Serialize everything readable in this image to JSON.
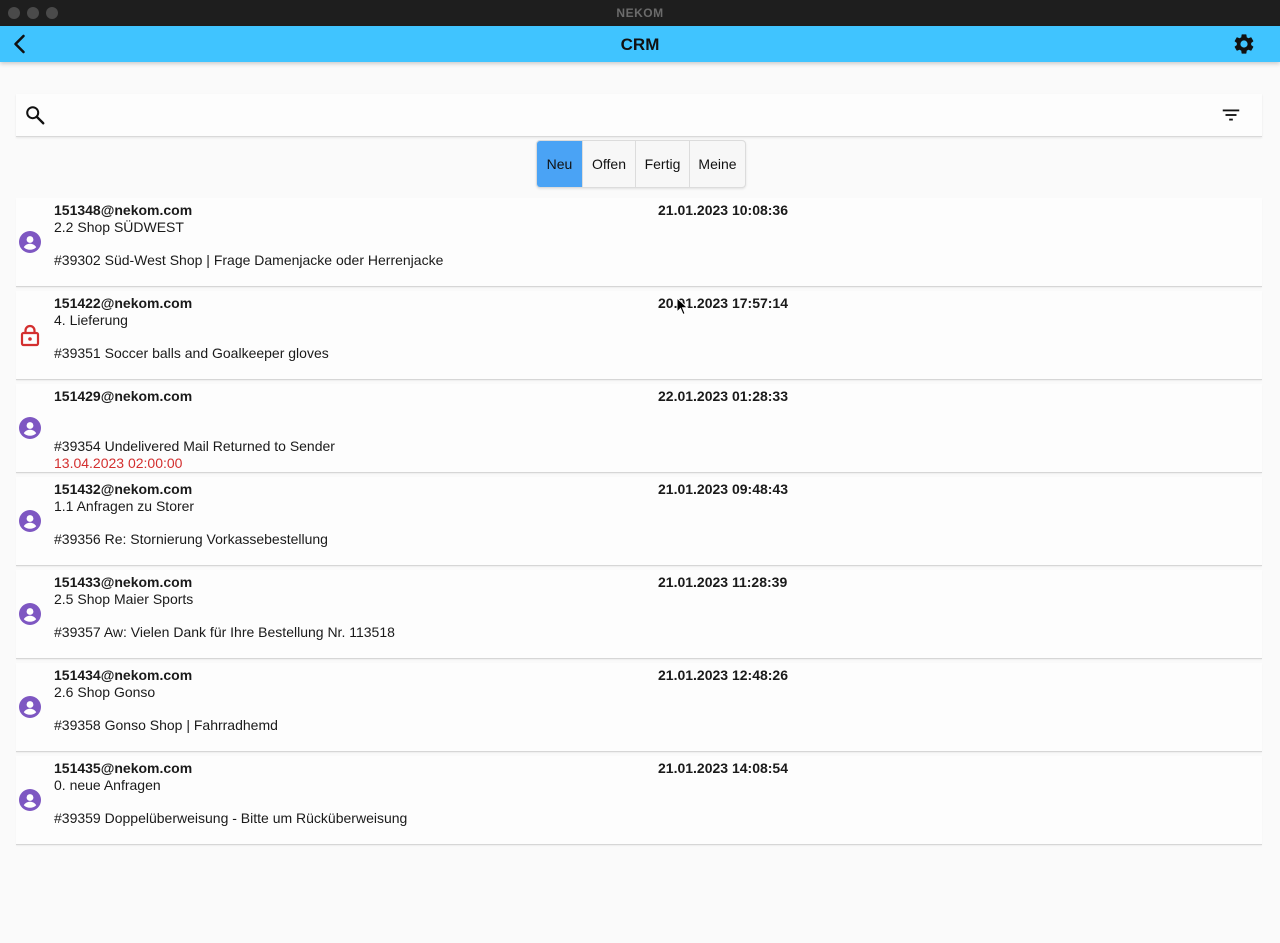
{
  "window": {
    "title": "NEKOM"
  },
  "appbar": {
    "title": "CRM",
    "back_icon": "arrow-back-icon",
    "settings_icon": "gear-icon"
  },
  "search": {
    "value": "",
    "placeholder": "",
    "filter_icon": "filter-list-icon"
  },
  "tabs": [
    {
      "label": "Neu",
      "active": true
    },
    {
      "label": "Offen",
      "active": false
    },
    {
      "label": "Fertig",
      "active": false
    },
    {
      "label": "Meine",
      "active": false
    }
  ],
  "colors": {
    "appbar": "#40c4ff",
    "active_tab": "#4aa3f5",
    "person_icon": "#7e57c2",
    "lock_icon": "#d32f2f",
    "due_date": "#d32f2f"
  },
  "tickets": [
    {
      "icon": "person-icon",
      "email": "151348@nekom.com",
      "date": "21.01.2023 10:08:36",
      "category": "2.2 Shop SÜDWEST",
      "subject": "#39302 Süd-West Shop | Frage Damenjacke oder Herrenjacke",
      "due": ""
    },
    {
      "icon": "lock-icon",
      "email": "151422@nekom.com",
      "date": "20.01.2023 17:57:14",
      "category": "4. Lieferung",
      "subject": "#39351 Soccer balls and Goalkeeper gloves",
      "due": ""
    },
    {
      "icon": "person-icon",
      "email": "151429@nekom.com",
      "date": "22.01.2023 01:28:33",
      "category": "",
      "subject": "#39354 Undelivered Mail Returned to Sender",
      "due": "13.04.2023 02:00:00"
    },
    {
      "icon": "person-icon",
      "email": "151432@nekom.com",
      "date": "21.01.2023 09:48:43",
      "category": "1.1 Anfragen zu Storer",
      "subject": "#39356 Re: Stornierung Vorkassebestellung",
      "due": ""
    },
    {
      "icon": "person-icon",
      "email": "151433@nekom.com",
      "date": "21.01.2023 11:28:39",
      "category": "2.5 Shop Maier Sports",
      "subject": "#39357 Aw: Vielen Dank für Ihre Bestellung Nr. 113518",
      "due": ""
    },
    {
      "icon": "person-icon",
      "email": "151434@nekom.com",
      "date": "21.01.2023 12:48:26",
      "category": "2.6 Shop Gonso",
      "subject": "#39358 Gonso Shop | Fahrradhemd",
      "due": ""
    },
    {
      "icon": "person-icon",
      "email": "151435@nekom.com",
      "date": "21.01.2023 14:08:54",
      "category": "0. neue Anfragen",
      "subject": "#39359 Doppelüberweisung - Bitte um Rücküberweisung",
      "due": ""
    }
  ]
}
